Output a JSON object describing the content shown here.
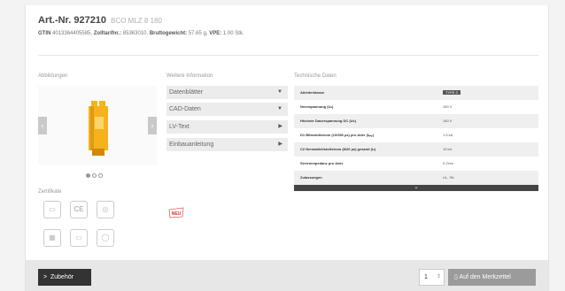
{
  "header": {
    "title": "Art.-Nr. 927210",
    "subtitle": "BCO MLZ 8 180",
    "gtin_label": "GTIN",
    "gtin_value": "4013364405585",
    "zolltarif_label": "Zolltarifnr.:",
    "zolltarif_value": "85363010",
    "brutto_label": "Bruttogewicht:",
    "brutto_value": "57.65 g",
    "vpe_label": "VPE:",
    "vpe_value": "1.00 Stk."
  },
  "gallery": {
    "label": "Abbildungen",
    "prev": "‹",
    "next": "›",
    "dots_total": 3,
    "active_dot": 0
  },
  "certificates": {
    "label": "Zertifikate",
    "items": [
      "cert-doc-icon",
      "ce-icon",
      "ul-icon",
      "qr-icon",
      "doc-icon",
      "ul-listed-icon"
    ],
    "ce_text": "CE"
  },
  "info": {
    "label": "Weitere Information",
    "items": [
      {
        "label": "Datenblätter",
        "arrow": "▼"
      },
      {
        "label": "CAD-Daten",
        "arrow": "▼"
      },
      {
        "label": "LV-Text",
        "arrow": "▶"
      },
      {
        "label": "Einbauanleitung",
        "arrow": "▶"
      }
    ],
    "new_badge": "NEU"
  },
  "tech": {
    "label": "Technische Daten",
    "rows": [
      {
        "key": "Ableiterklasse",
        "value": "TYPE 3"
      },
      {
        "key": "Nennspannung (Uₙ)",
        "value": "180 V"
      },
      {
        "key": "Höchste Dauerspannung DC (Uᴄ)",
        "value": "180 V"
      },
      {
        "key": "D1 Blitzstoßstrom (10/350 µs) pro Ader (Iᵢₘₚ)",
        "value": "1.5 kA"
      },
      {
        "key": "C2 Nennableitstoßstrom (8/20 µs) gesamt (Iₙ)",
        "value": "10 kA"
      },
      {
        "key": "Serienimpedanz pro Ader",
        "value": "0 Ohm"
      },
      {
        "key": "Zulassungen",
        "value": "UL, SIL"
      }
    ],
    "expand": "⌄"
  },
  "bottom": {
    "zubehoer": "Zubehör",
    "zubehoer_arrow": ">",
    "qty": "1",
    "qty_spin": "⇕",
    "merkzettel": "Auf den Merkzettel",
    "merkzettel_icon": "▯"
  },
  "colors": {
    "product_yellow": "#f5b21c",
    "new_red": "#d32f2f",
    "dark": "#333333"
  }
}
